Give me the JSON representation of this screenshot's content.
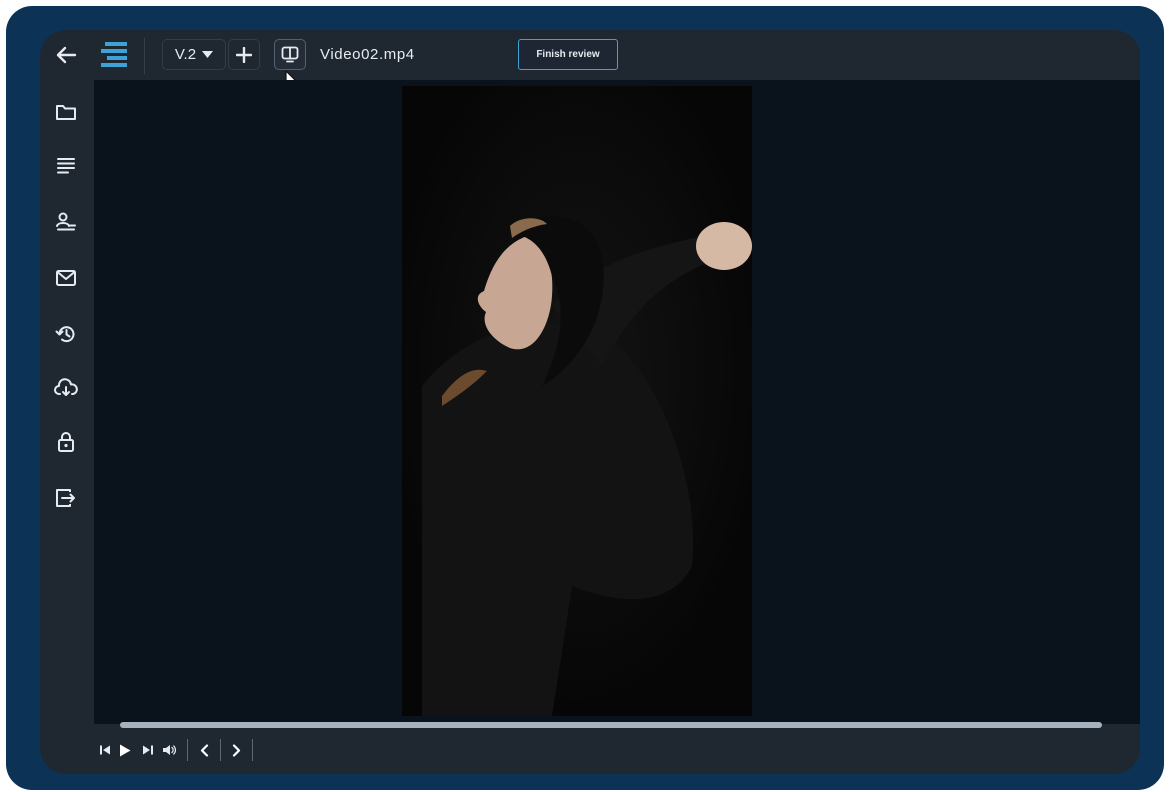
{
  "toolbar": {
    "version_label": "V.2",
    "file_name": "Video02.mp4",
    "finish_review_label": "Finish review"
  },
  "icons": {
    "back": "arrow-left-icon",
    "logo": "logo-icon",
    "version_dropdown": "caret-down-icon",
    "add": "plus-icon",
    "compare": "compare-view-icon",
    "cursor": "mouse-pointer-icon"
  },
  "sidebar": {
    "items": [
      {
        "name": "folder-icon"
      },
      {
        "name": "list-icon"
      },
      {
        "name": "user-list-icon"
      },
      {
        "name": "mail-icon"
      },
      {
        "name": "history-icon"
      },
      {
        "name": "cloud-download-icon"
      },
      {
        "name": "lock-icon"
      },
      {
        "name": "export-icon"
      }
    ]
  },
  "player": {
    "controls": [
      "skip-back-icon",
      "play-icon",
      "skip-forward-icon",
      "volume-icon",
      "previous-frame-icon",
      "next-frame-icon"
    ]
  },
  "colors": {
    "frame": "#0c3355",
    "app_background": "#1f2731",
    "viewer_background": "#0a121c",
    "accent": "#3ea2d6",
    "text": "#e7ebf0"
  }
}
